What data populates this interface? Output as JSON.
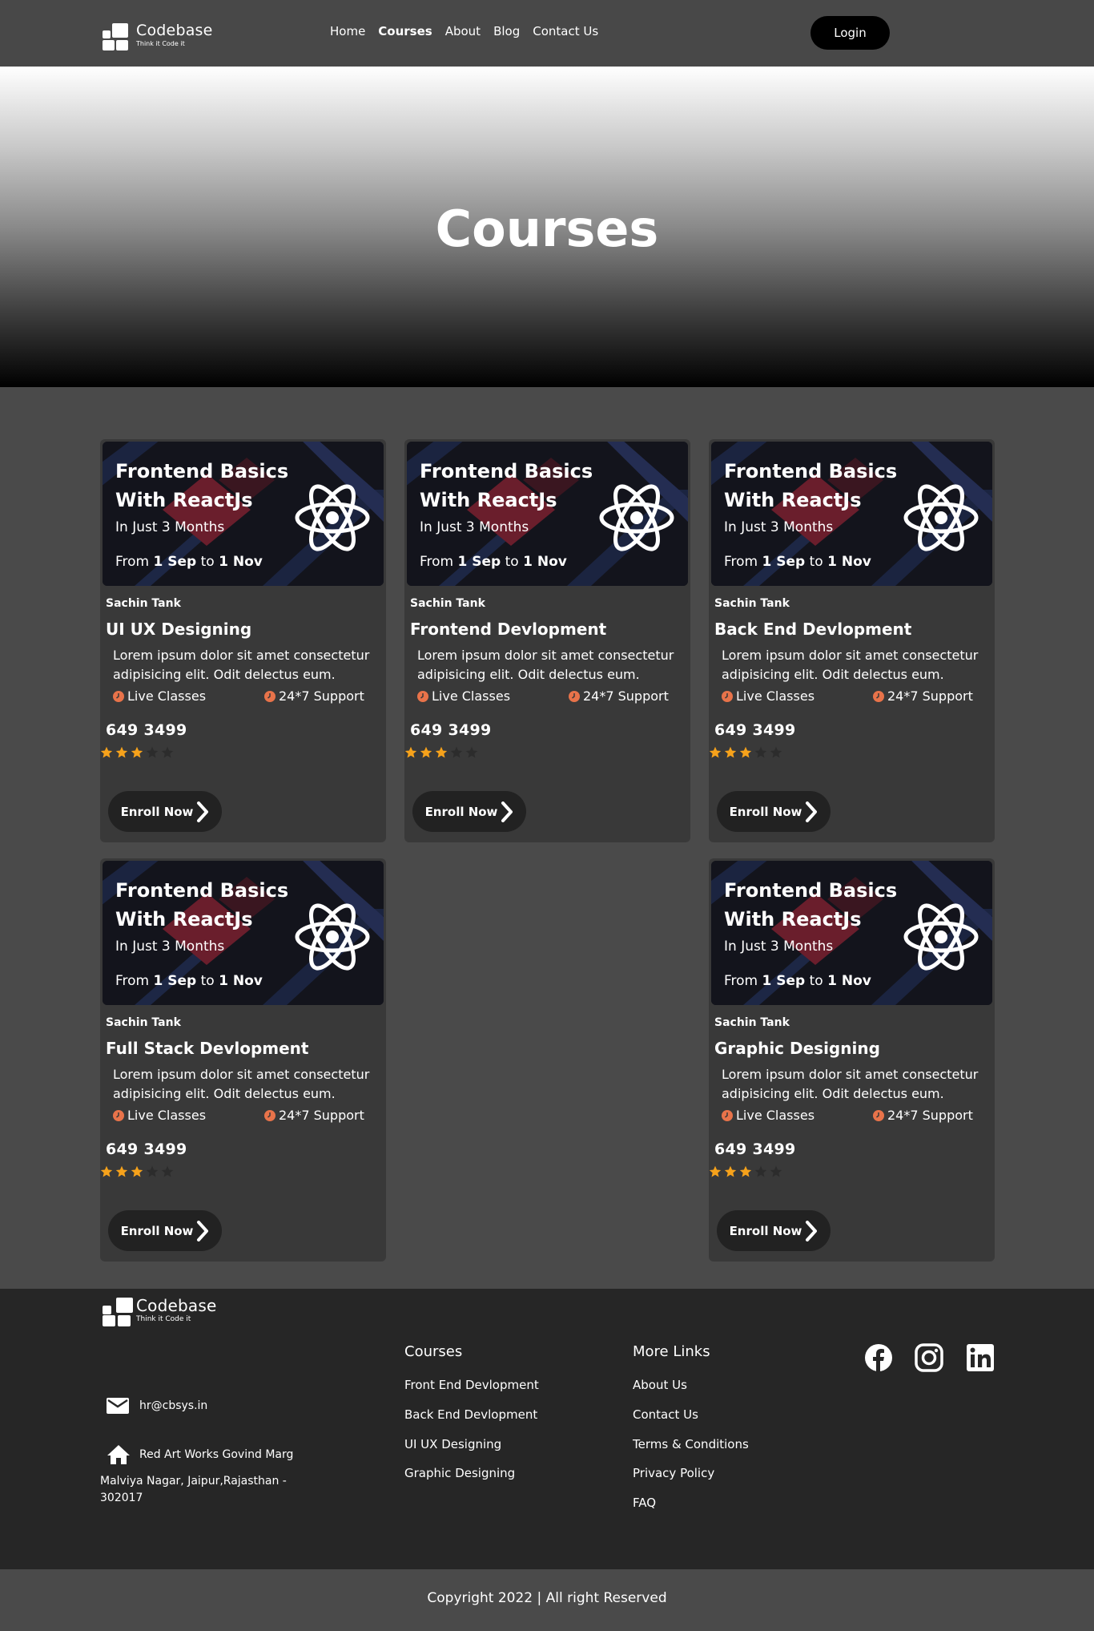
{
  "brand": {
    "name": "Codebase",
    "tagline": "Think it Code it"
  },
  "nav": {
    "links": [
      {
        "label": "Home"
      },
      {
        "label": "Courses",
        "active": true
      },
      {
        "label": "About"
      },
      {
        "label": "Blog"
      },
      {
        "label": "Contact Us"
      }
    ],
    "login_label": "Login"
  },
  "hero": {
    "title": "Courses"
  },
  "cards": [
    {
      "banner_line1": "Frontend Basics",
      "banner_line2": "With ReactJs",
      "banner_sub": "In Just 3 Months",
      "banner_from": "From",
      "banner_start": "1 Sep",
      "banner_to": "to",
      "banner_end": "1 Nov",
      "instructor": "Sachin Tank",
      "title": "UI UX Designing",
      "description": "Lorem ipsum dolor sit amet consectetur adipisicing elit. Odit delectus eum.",
      "feature1": "Live Classes",
      "feature2": "24*7 Support",
      "price": "649 3499",
      "rating": 3,
      "rating_max": 5,
      "enroll_label": "Enroll Now"
    },
    {
      "banner_line1": "Frontend Basics",
      "banner_line2": "With ReactJs",
      "banner_sub": "In Just 3 Months",
      "banner_from": "From",
      "banner_start": "1 Sep",
      "banner_to": "to",
      "banner_end": "1 Nov",
      "instructor": "Sachin Tank",
      "title": "Frontend Devlopment",
      "description": "Lorem ipsum dolor sit amet consectetur adipisicing elit. Odit delectus eum.",
      "feature1": "Live Classes",
      "feature2": "24*7 Support",
      "price": "649 3499",
      "rating": 3,
      "rating_max": 5,
      "enroll_label": "Enroll Now"
    },
    {
      "banner_line1": "Frontend Basics",
      "banner_line2": "With ReactJs",
      "banner_sub": "In Just 3 Months",
      "banner_from": "From",
      "banner_start": "1 Sep",
      "banner_to": "to",
      "banner_end": "1 Nov",
      "instructor": "Sachin Tank",
      "title": "Back End Devlopment",
      "description": "Lorem ipsum dolor sit amet consectetur adipisicing elit. Odit delectus eum.",
      "feature1": "Live Classes",
      "feature2": "24*7 Support",
      "price": "649 3499",
      "rating": 3,
      "rating_max": 5,
      "enroll_label": "Enroll Now"
    },
    {
      "banner_line1": "Frontend Basics",
      "banner_line2": "With ReactJs",
      "banner_sub": "In Just 3 Months",
      "banner_from": "From",
      "banner_start": "1 Sep",
      "banner_to": "to",
      "banner_end": "1 Nov",
      "instructor": "Sachin Tank",
      "title": "Full Stack Devlopment",
      "description": "Lorem ipsum dolor sit amet consectetur adipisicing elit. Odit delectus eum.",
      "feature1": "Live Classes",
      "feature2": "24*7 Support",
      "price": "649 3499",
      "rating": 3,
      "rating_max": 5,
      "enroll_label": "Enroll Now"
    },
    {
      "banner_line1": "Frontend Basics",
      "banner_line2": "With ReactJs",
      "banner_sub": "In Just 3 Months",
      "banner_from": "From",
      "banner_start": "1 Sep",
      "banner_to": "to",
      "banner_end": "1 Nov",
      "instructor": "Sachin Tank",
      "title": "Graphic Designing",
      "description": "Lorem ipsum dolor sit amet consectetur adipisicing elit. Odit delectus eum.",
      "feature1": "Live Classes",
      "feature2": "24*7 Support",
      "price": "649 3499",
      "rating": 3,
      "rating_max": 5,
      "enroll_label": "Enroll Now"
    }
  ],
  "footer": {
    "email": "hr@cbsys.in",
    "address_line1": "Red Art Works Govind Marg",
    "address_line2": "Malviya Nagar, Jaipur,Rajasthan -",
    "address_line3": "302017",
    "courses_title": "Courses",
    "courses": [
      "Front End Devlopment",
      "Back End Devlopment",
      "UI UX Designing",
      "Graphic Designing"
    ],
    "more_title": "More Links",
    "more": [
      "About Us",
      "Contact Us",
      "Terms & Conditions",
      "Privacy Policy",
      "FAQ"
    ],
    "social_icons": [
      "facebook-icon",
      "instagram-icon",
      "linkedin-icon"
    ]
  },
  "copyright": "Copyright 2022 | All right Reserved",
  "colors": {
    "page_bg": "#4a4a4a",
    "card_bg": "#393939",
    "button_bg": "#222222",
    "star_active": "#f6a21b",
    "feature_icon": "#e8734a",
    "footer_bg": "#262626"
  }
}
